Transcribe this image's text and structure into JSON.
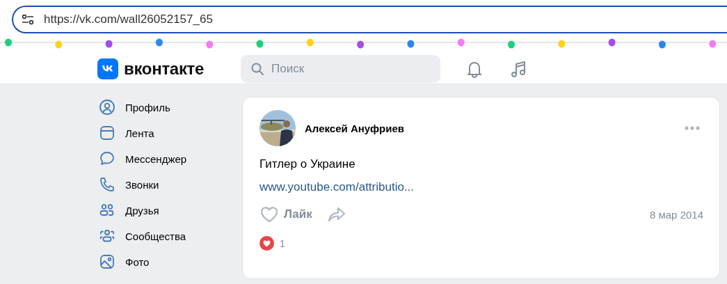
{
  "address_bar": {
    "url": "https://vk.com/wall26052157_65"
  },
  "header": {
    "logo_text": "вконтакте",
    "search": {
      "placeholder": "Поиск"
    }
  },
  "sidebar": {
    "items": [
      {
        "label": "Профиль",
        "kind": "profile"
      },
      {
        "label": "Лента",
        "kind": "feed"
      },
      {
        "label": "Мессенджер",
        "kind": "messenger"
      },
      {
        "label": "Звонки",
        "kind": "calls"
      },
      {
        "label": "Друзья",
        "kind": "friends"
      },
      {
        "label": "Сообщества",
        "kind": "communities"
      },
      {
        "label": "Фото"
      }
    ]
  },
  "post": {
    "author": "Алексей Ануфриев",
    "text": "Гитлер о Украине",
    "link": "www.youtube.com/attributio...",
    "like_label": "Лайк",
    "liked": false,
    "date": "8 мар 2014",
    "reactions_count": "1"
  }
}
